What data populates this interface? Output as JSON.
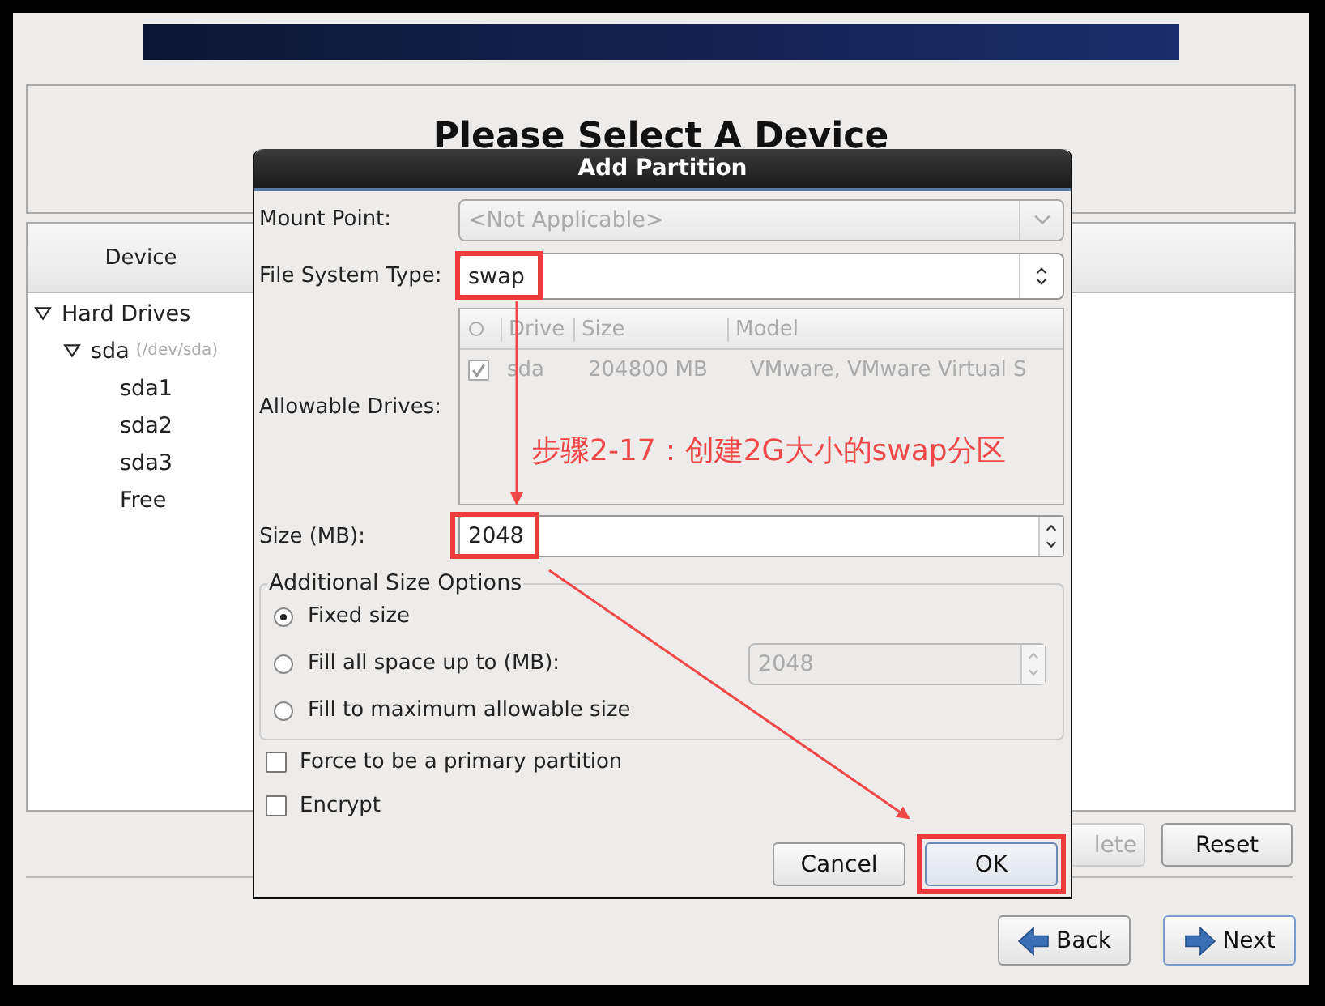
{
  "installer": {
    "title": "Please Select A Device",
    "device_table": {
      "columns": [
        "Device"
      ],
      "tree": [
        {
          "label": "Hard Drives",
          "expanded": true,
          "children": [
            {
              "label": "sda",
              "detail": "(/dev/sda)",
              "expanded": true,
              "children": [
                {
                  "label": "sda1"
                },
                {
                  "label": "sda2"
                },
                {
                  "label": "sda3"
                },
                {
                  "label": "Free"
                }
              ]
            }
          ]
        }
      ]
    },
    "buttons": [
      {
        "label": "lete",
        "disabled": true
      },
      {
        "label": "Reset",
        "disabled": false
      }
    ],
    "nav": [
      {
        "label": "Back",
        "kind": "back"
      },
      {
        "label": "Next",
        "kind": "next"
      }
    ]
  },
  "dialog": {
    "title": "Add Partition",
    "mount_point": {
      "label": "Mount Point:",
      "value": "<Not Applicable>",
      "disabled": true
    },
    "file_system_type": {
      "label": "File System Type:",
      "value": "swap",
      "highlighted": true
    },
    "allowable_drives": {
      "label": "Allowable Drives:",
      "disabled": true,
      "columns": [
        "Drive",
        "Size",
        "Model"
      ],
      "rows": [
        {
          "checked": true,
          "cells": [
            "sda",
            "204800 MB",
            "VMware, VMware Virtual S"
          ]
        }
      ]
    },
    "size": {
      "label": "Size (MB):",
      "value": "2048",
      "highlighted": true
    },
    "size_options": {
      "title": "Additional Size Options",
      "options": [
        {
          "label": "Fixed size",
          "selected": true
        },
        {
          "label": "Fill all space up to (MB):",
          "selected": false,
          "value": "2048",
          "disabled": true
        },
        {
          "label": "Fill to maximum allowable size",
          "selected": false
        }
      ]
    },
    "checkboxes": [
      {
        "label": "Force to be a primary partition",
        "checked": false
      },
      {
        "label": "Encrypt",
        "checked": false
      }
    ],
    "buttons": [
      {
        "label": "Cancel",
        "kind": "normal",
        "highlighted": false
      },
      {
        "label": "OK",
        "kind": "default",
        "highlighted": true
      }
    ]
  },
  "annotation": {
    "text": "步骤2-17：创建2G大小的swap分区"
  }
}
